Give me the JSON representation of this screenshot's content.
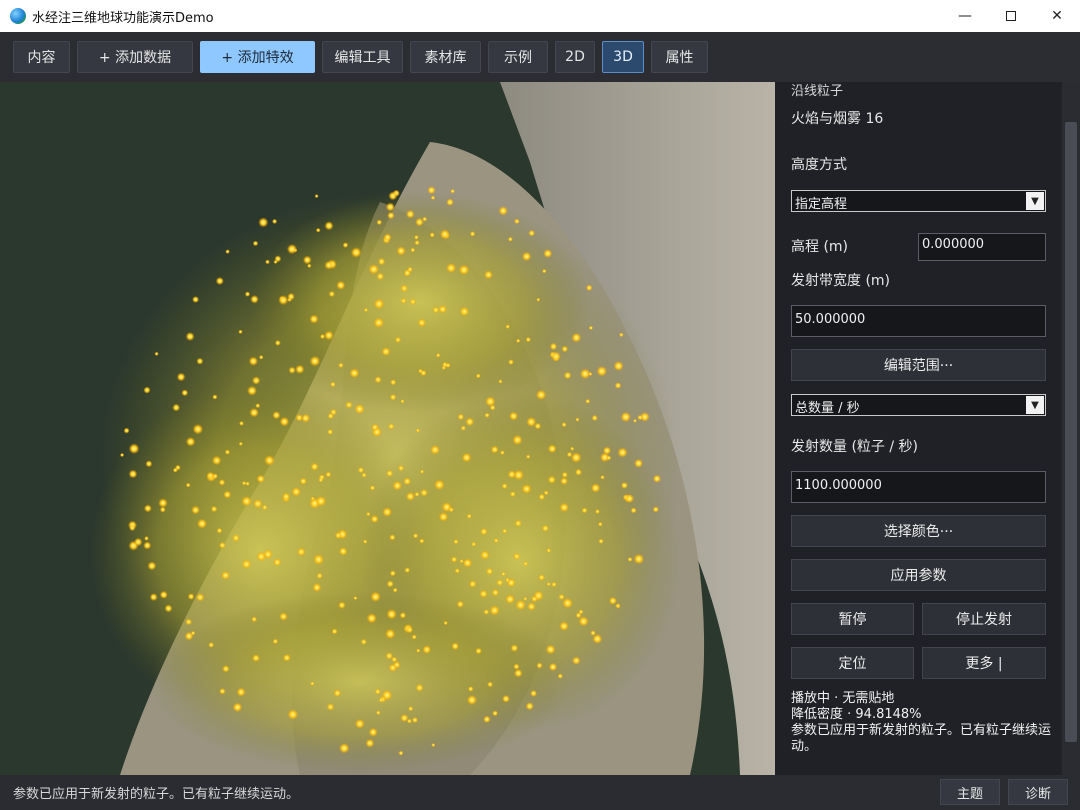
{
  "window": {
    "title": "水经注三维地球功能演示Demo"
  },
  "toolbar": {
    "content": "内容",
    "add_data": "+ 添加数据",
    "add_effect": "+ 添加特效",
    "edit_tools": "编辑工具",
    "material_library": "素材库",
    "examples": "示例",
    "mode_2d": "2D",
    "mode_3d": "3D",
    "properties": "属性"
  },
  "panel": {
    "section_title": "沿线粒子",
    "effect_name": "火焰与烟雾 16",
    "height_mode_label": "高度方式",
    "height_mode_value": "指定高程",
    "elevation_label": "高程 (m)",
    "elevation_value": "0.000000",
    "band_width_label": "发射带宽度 (m)",
    "band_width_value": "50.000000",
    "edit_range_button": "编辑范围···",
    "rate_mode_value": "总数量 / 秒",
    "emit_count_label": "发射数量 (粒子 / 秒)",
    "emit_count_value": "1100.000000",
    "choose_color_button": "选择颜色···",
    "apply_button": "应用参数",
    "pause_button": "暂停",
    "stop_button": "停止发射",
    "locate_button": "定位",
    "more_button": "更多 |",
    "status_line1": "播放中 · 无需贴地",
    "status_line2": "降低密度 · 94.8148%",
    "status_line3": "参数已应用于新发射的粒子。已有粒子继续运动。"
  },
  "statusbar": {
    "message": "参数已应用于新发射的粒子。已有粒子继续运动。",
    "theme_button": "主题",
    "diagnose_button": "诊断"
  },
  "colors": {
    "toolbar_bg": "#2b2d33",
    "accent_active": "#8fc7ff",
    "particle_core": "#ffd21f",
    "smoke": "#b7b23a"
  }
}
